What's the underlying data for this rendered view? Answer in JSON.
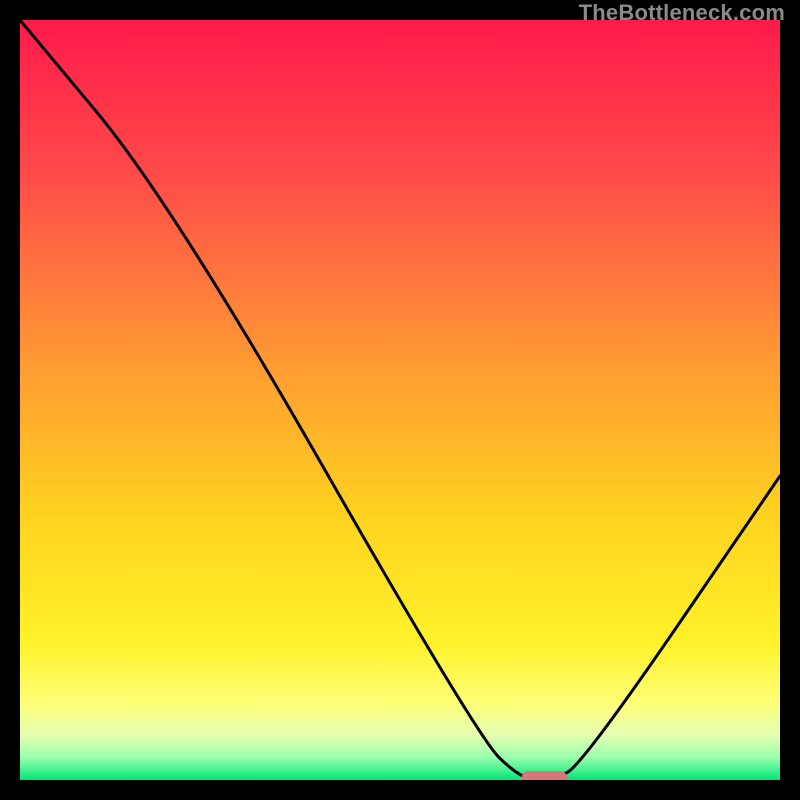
{
  "watermark": "TheBottleneck.com",
  "chart_data": {
    "type": "line",
    "title": "",
    "xlabel": "",
    "ylabel": "",
    "xlim": [
      0,
      100
    ],
    "ylim": [
      0,
      100
    ],
    "series": [
      {
        "name": "bottleneck-curve",
        "x": [
          0,
          20,
          60,
          66,
          70,
          74,
          100
        ],
        "values": [
          100,
          76,
          6,
          0,
          0,
          2,
          40
        ]
      }
    ],
    "marker": {
      "name": "optimal-range",
      "x_start": 66,
      "x_end": 72,
      "y": 0,
      "color": "#d6787a"
    },
    "gradient_stops": [
      {
        "pos": 0.0,
        "color": "#ff1a4b"
      },
      {
        "pos": 0.2,
        "color": "#ff4a4a"
      },
      {
        "pos": 0.45,
        "color": "#ff9a33"
      },
      {
        "pos": 0.65,
        "color": "#ffd21f"
      },
      {
        "pos": 0.82,
        "color": "#fff22a"
      },
      {
        "pos": 0.9,
        "color": "#fdff79"
      },
      {
        "pos": 0.94,
        "color": "#e6ffb0"
      },
      {
        "pos": 0.97,
        "color": "#9bffb0"
      },
      {
        "pos": 1.0,
        "color": "#00e676"
      }
    ]
  }
}
